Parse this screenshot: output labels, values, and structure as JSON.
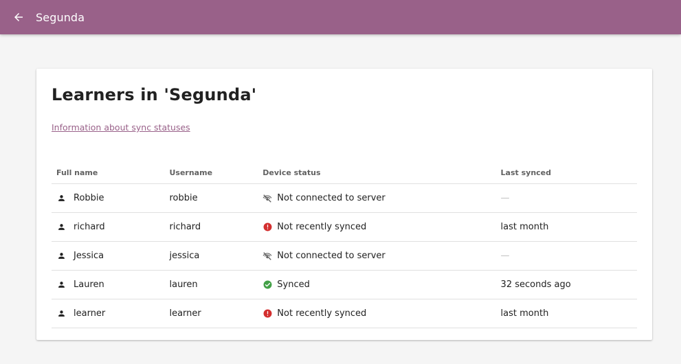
{
  "header": {
    "title": "Segunda",
    "back_icon": "arrow-back-icon"
  },
  "main": {
    "title": "Learners in 'Segunda'",
    "info_link": "Information about sync statuses"
  },
  "table": {
    "columns": [
      "Full name",
      "Username",
      "Device status",
      "Last synced"
    ],
    "rows": [
      {
        "full_name": "Robbie",
        "username": "robbie",
        "status": "Not connected to server",
        "status_icon": "not-connected-icon",
        "last_synced": "—"
      },
      {
        "full_name": "richard",
        "username": "richard",
        "status": "Not recently synced",
        "status_icon": "error-icon",
        "last_synced": "last month"
      },
      {
        "full_name": "Jessica",
        "username": "jessica",
        "status": "Not connected to server",
        "status_icon": "not-connected-icon",
        "last_synced": "—"
      },
      {
        "full_name": "Lauren",
        "username": "lauren",
        "status": "Synced",
        "status_icon": "check-circle-icon",
        "last_synced": "32 seconds ago"
      },
      {
        "full_name": "learner",
        "username": "learner",
        "status": "Not recently synced",
        "status_icon": "error-icon",
        "last_synced": "last month"
      }
    ]
  },
  "colors": {
    "brand": "#996189",
    "error": "#d32f2f",
    "success": "#43a047",
    "muted_icon": "#616161"
  }
}
